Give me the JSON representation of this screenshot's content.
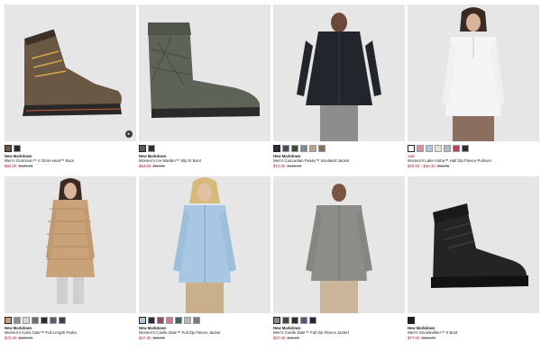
{
  "products": [
    {
      "tag": "New Markdown",
      "name": "Men's Gunnison™ II Omni-Heat™ Boot",
      "price": "$84.00",
      "was": "$120.00",
      "swatch_colors": [
        "#6b5a45",
        "#2b2b2b"
      ],
      "image": "brown-boot"
    },
    {
      "tag": "New Markdown",
      "name": "Women's Ice Maiden™ Slip III Boot",
      "price": "$63.00",
      "was": "$90.00",
      "swatch_colors": [
        "#5a5f52",
        "#2e2e2e"
      ],
      "image": "grey-slip-boot"
    },
    {
      "tag": "New Markdown",
      "name": "Men's Cascadian Peaks™ Insulated Jacket",
      "price": "$72.00",
      "was": "$120.00",
      "swatch_colors": [
        "#2b2d33",
        "#4a4f57",
        "#3e4a3d",
        "#7a8a99",
        "#b8a48a",
        "#8a6a52"
      ],
      "image": "black-jacket"
    },
    {
      "tag": "Sale",
      "name": "Women's Lake Aloha™ Half Zip Fleece Pullover",
      "price": "$20.00 - $36.30",
      "was": "$55.00",
      "swatch_colors": [
        "#f4f4f4",
        "#d98fa0",
        "#b3c7de",
        "#e7e2d6",
        "#b7b9bd",
        "#c43c55",
        "#2d2d2d"
      ],
      "image": "white-pullover"
    },
    {
      "tag": "New Markdown",
      "name": "Women's Karis Gale™ Full Length Parka",
      "price": "$72.00",
      "was": "$120.00",
      "swatch_colors": [
        "#c8a27a",
        "#8e8f8c",
        "#d8d6d0",
        "#6a6f74",
        "#2d2d2d",
        "#58606b",
        "#3f4147"
      ],
      "image": "tan-parka"
    },
    {
      "tag": "New Markdown",
      "name": "Women's Castle Dale™ Full Zip Fleece Jacket",
      "price": "$27.30",
      "was": "$55.00",
      "swatch_colors": [
        "#a9c8e4",
        "#2d2d2d",
        "#8a4a6a",
        "#d27891",
        "#3a6a5a",
        "#b9b9b9",
        "#7b7e83"
      ],
      "image": "blue-fleece"
    },
    {
      "tag": "New Markdown",
      "name": "Men's Castle Dale™ Full Zip Fleece Jacket",
      "price": "$27.00",
      "was": "$45.00",
      "swatch_colors": [
        "#8b8b88",
        "#3a4d3c",
        "#2b2b2b",
        "#4a5a78",
        "#23262b"
      ],
      "image": "grey-fleece"
    },
    {
      "tag": "New Markdown",
      "name": "Men's Snowtrekker™ II Boot",
      "price": "$77.00",
      "was": "$110.00",
      "swatch_colors": [
        "#1f1f1f"
      ],
      "image": "black-boot"
    }
  ]
}
